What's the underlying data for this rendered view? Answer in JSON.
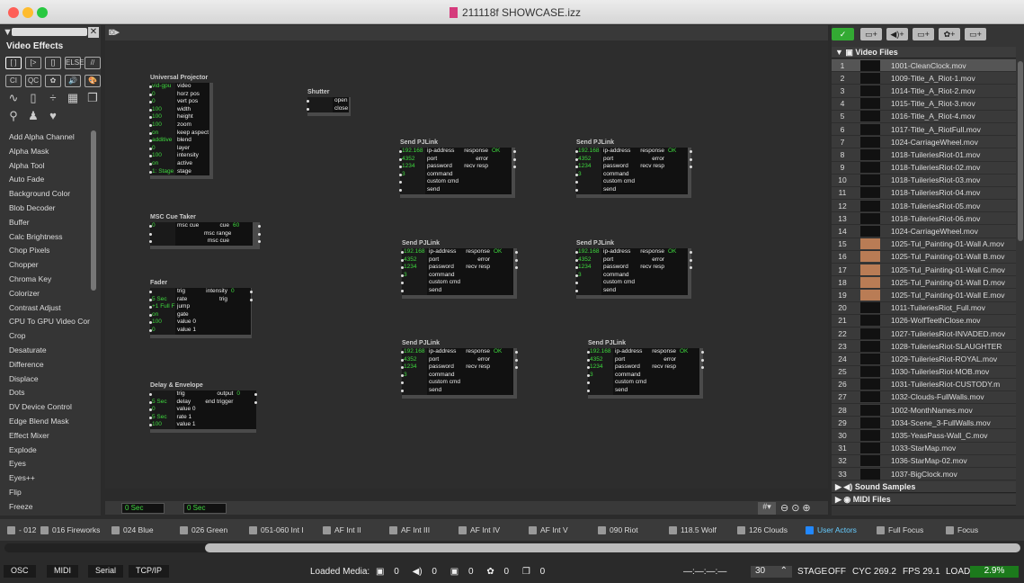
{
  "window": {
    "title": "211118f SHOWCASE.izz"
  },
  "left_panel": {
    "title": "Video Effects",
    "icons_row1": [
      "[ ]",
      "[>",
      "[]",
      "ELSE",
      "//"
    ],
    "icons_row2": [
      "CI",
      "QC",
      "✿",
      "🔊",
      "🎨"
    ],
    "effects": [
      "Add Alpha Channel",
      "Alpha Mask",
      "Alpha Tool",
      "Auto Fade",
      "Background Color",
      "Blob Decoder",
      "Buffer",
      "Calc Brightness",
      "Chop Pixels",
      "Chopper",
      "Chroma Key",
      "Colorizer",
      "Contrast Adjust",
      "CPU To GPU Video Cor",
      "Crop",
      "Desaturate",
      "Difference",
      "Displace",
      "Dots",
      "DV Device Control",
      "Edge Blend Mask",
      "Effect Mixer",
      "Explode",
      "Eyes",
      "Eyes++",
      "Flip",
      "Freeze"
    ]
  },
  "nodes": {
    "projector": {
      "title": "Universal Projector",
      "rows": [
        [
          "vid-gpu",
          "video"
        ],
        [
          "0",
          "horz pos"
        ],
        [
          "0",
          "vert pos"
        ],
        [
          "100",
          "width"
        ],
        [
          "100",
          "height"
        ],
        [
          "100",
          "zoom"
        ],
        [
          "on",
          "keep aspect"
        ],
        [
          "additive",
          "blend"
        ],
        [
          "0",
          "layer"
        ],
        [
          "100",
          "intensity"
        ],
        [
          "on",
          "active"
        ],
        [
          "1: Stage",
          "stage"
        ]
      ]
    },
    "shutter": {
      "title": "Shutter",
      "rows": [
        [
          "",
          "open"
        ],
        [
          "",
          "close"
        ]
      ]
    },
    "cue": {
      "title": "MSC Cue Taker",
      "rows": [
        [
          "0",
          "msc cue",
          "cue",
          "60"
        ],
        [
          "",
          "",
          "msc range",
          ""
        ],
        [
          "",
          "",
          "msc cue",
          ""
        ]
      ]
    },
    "fader": {
      "title": "Fader",
      "rows": [
        [
          "",
          "trig",
          "intensity",
          "0"
        ],
        [
          "5 Sec",
          "rate",
          "trig",
          ""
        ],
        [
          "+1 Full F",
          "jump",
          "",
          ""
        ],
        [
          "on",
          "gate",
          "",
          ""
        ],
        [
          "100",
          "value 0",
          "",
          ""
        ],
        [
          "0",
          "value 1",
          "",
          ""
        ]
      ]
    },
    "delay": {
      "title": "Delay & Envelope",
      "rows": [
        [
          "",
          "trig",
          "output",
          "0"
        ],
        [
          "5 Sec",
          "delay",
          "end trigger",
          ""
        ],
        [
          "0",
          "value 0",
          "",
          ""
        ],
        [
          "5 Sec",
          "rate 1",
          "",
          ""
        ],
        [
          "100",
          "value 1",
          "",
          ""
        ]
      ]
    },
    "pjlink_title": "Send PJLink",
    "pjlink_rows": [
      [
        "192.168",
        "ip-address",
        "response",
        "OK"
      ],
      [
        "4352",
        "port",
        "error",
        ""
      ],
      [
        "1234",
        "password",
        "recv resp",
        ""
      ],
      [
        "3",
        "command",
        "",
        ""
      ],
      [
        "",
        "custom cmd",
        "",
        ""
      ],
      [
        "",
        "send",
        "",
        ""
      ]
    ]
  },
  "canvas_bottom": {
    "time1": "0 Sec",
    "time2": "0 Sec"
  },
  "right_panel": {
    "sections": {
      "video": "Video Files",
      "sound": "Sound Samples",
      "midi": "MIDI Files"
    },
    "tools": [
      "✓",
      "▭+",
      "◀)+",
      "▭+",
      "✿+",
      "▭+"
    ],
    "media": [
      {
        "n": "1",
        "name": "1001-CleanClock.mov",
        "sel": true
      },
      {
        "n": "2",
        "name": "1009-Title_A_Riot-1.mov"
      },
      {
        "n": "3",
        "name": "1014-Title_A_Riot-2.mov"
      },
      {
        "n": "4",
        "name": "1015-Title_A_Riot-3.mov"
      },
      {
        "n": "5",
        "name": "1016-Title_A_Riot-4.mov"
      },
      {
        "n": "6",
        "name": "1017-Title_A_RiotFull.mov"
      },
      {
        "n": "7",
        "name": "1024-CarriageWheel.mov"
      },
      {
        "n": "8",
        "name": "1018-TuileriesRiot-01.mov"
      },
      {
        "n": "9",
        "name": "1018-TuileriesRiot-02.mov"
      },
      {
        "n": "10",
        "name": "1018-TuileriesRiot-03.mov"
      },
      {
        "n": "11",
        "name": "1018-TuileriesRiot-04.mov"
      },
      {
        "n": "12",
        "name": "1018-TuileriesRiot-05.mov"
      },
      {
        "n": "13",
        "name": "1018-TuileriesRiot-06.mov"
      },
      {
        "n": "14",
        "name": "1024-CarriageWheel.mov"
      },
      {
        "n": "15",
        "name": "1025-Tul_Painting-01-Wall A.mov",
        "lt": true
      },
      {
        "n": "16",
        "name": "1025-Tul_Painting-01-Wall B.mov",
        "lt": true
      },
      {
        "n": "17",
        "name": "1025-Tul_Painting-01-Wall C.mov",
        "lt": true
      },
      {
        "n": "18",
        "name": "1025-Tul_Painting-01-Wall D.mov",
        "lt": true
      },
      {
        "n": "19",
        "name": "1025-Tul_Painting-01-Wall E.mov",
        "lt": true
      },
      {
        "n": "20",
        "name": "1011-TuileriesRiot_Full.mov"
      },
      {
        "n": "21",
        "name": "1026-WolfTeethClose.mov"
      },
      {
        "n": "22",
        "name": "1027-TuileriesRiot-INVADED.mov"
      },
      {
        "n": "23",
        "name": "1028-TuileriesRiot-SLAUGHTER"
      },
      {
        "n": "24",
        "name": "1029-TuileriesRiot-ROYAL.mov"
      },
      {
        "n": "25",
        "name": "1030-TuileriesRiot-MOB.mov"
      },
      {
        "n": "26",
        "name": "1031-TuileriesRiot-CUSTODY.m"
      },
      {
        "n": "27",
        "name": "1032-Clouds-FullWalls.mov"
      },
      {
        "n": "28",
        "name": "1002-MonthNames.mov"
      },
      {
        "n": "29",
        "name": "1034-Scene_3-FullWalls.mov"
      },
      {
        "n": "30",
        "name": "1035-YeasPass-Wall_C.mov"
      },
      {
        "n": "31",
        "name": "1033-StarMap.mov"
      },
      {
        "n": "32",
        "name": "1036-StarMap-02.mov"
      },
      {
        "n": "33",
        "name": "1037-BigClock.mov"
      }
    ]
  },
  "scenes": [
    "- 012",
    "016 Fireworks",
    "024 Blue",
    "026 Green",
    "051-060 Int I",
    "AF Int II",
    "AF Int III",
    "AF Int IV",
    "AF Int V",
    "090 Riot",
    "118.5 Wolf",
    "126 Clouds",
    "User Actors",
    "Full Focus",
    "Focus"
  ],
  "selected_scene": "User Actors",
  "status": {
    "tabs": [
      "OSC",
      "MIDI",
      "Serial",
      "TCP/IP"
    ],
    "loaded_media": "Loaded Media:",
    "counts": [
      "0",
      "0",
      "0",
      "0",
      "0"
    ],
    "timecode": "—:—:—:—",
    "fps_value": "30",
    "stage_label": "STAGE",
    "stage_value": "OFF",
    "cyc": "CYC 269.2",
    "fps": "FPS 29.1",
    "load_label": "LOAD",
    "load_value": "2.9%"
  },
  "colors": {
    "accent_green": "#3fd93f",
    "selected_scene": "#28f"
  }
}
